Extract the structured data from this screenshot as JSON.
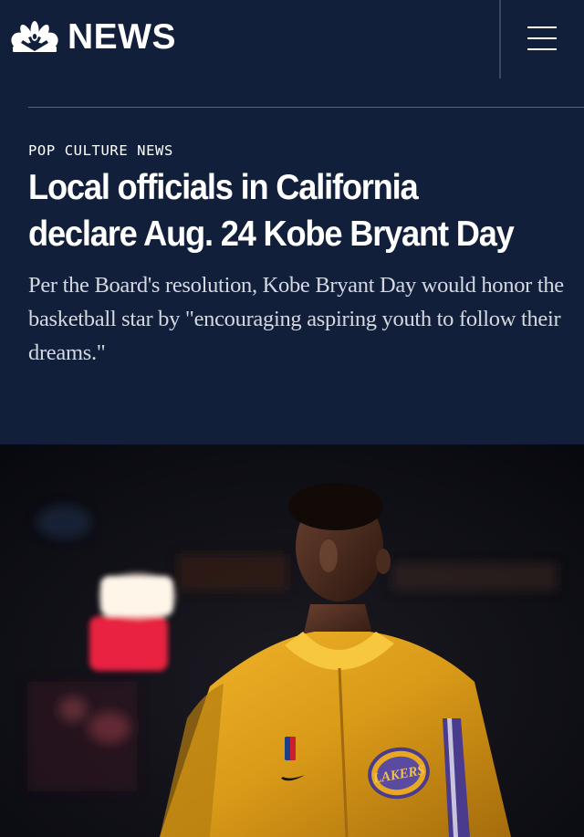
{
  "header": {
    "logo_text": "NEWS",
    "logo_icon": "peacock-icon",
    "menu_icon": "hamburger-menu-icon"
  },
  "article": {
    "category": "POP CULTURE NEWS",
    "headline": "Local officials in California declare Aug. 24 Kobe Bryant Day",
    "dek": "Per the Board's resolution, Kobe Bryant Day would honor the basketball star by \"encouraging aspiring youth to follow their dreams.\""
  },
  "hero_image": {
    "jersey_text": "LAKERS"
  },
  "colors": {
    "header_background": "#121f3b",
    "text_primary": "#ffffff",
    "text_secondary": "#d4d8e0",
    "divider": "#5a6680",
    "jersey_gold": "#e8a823",
    "jersey_purple": "#4a3b8c"
  }
}
